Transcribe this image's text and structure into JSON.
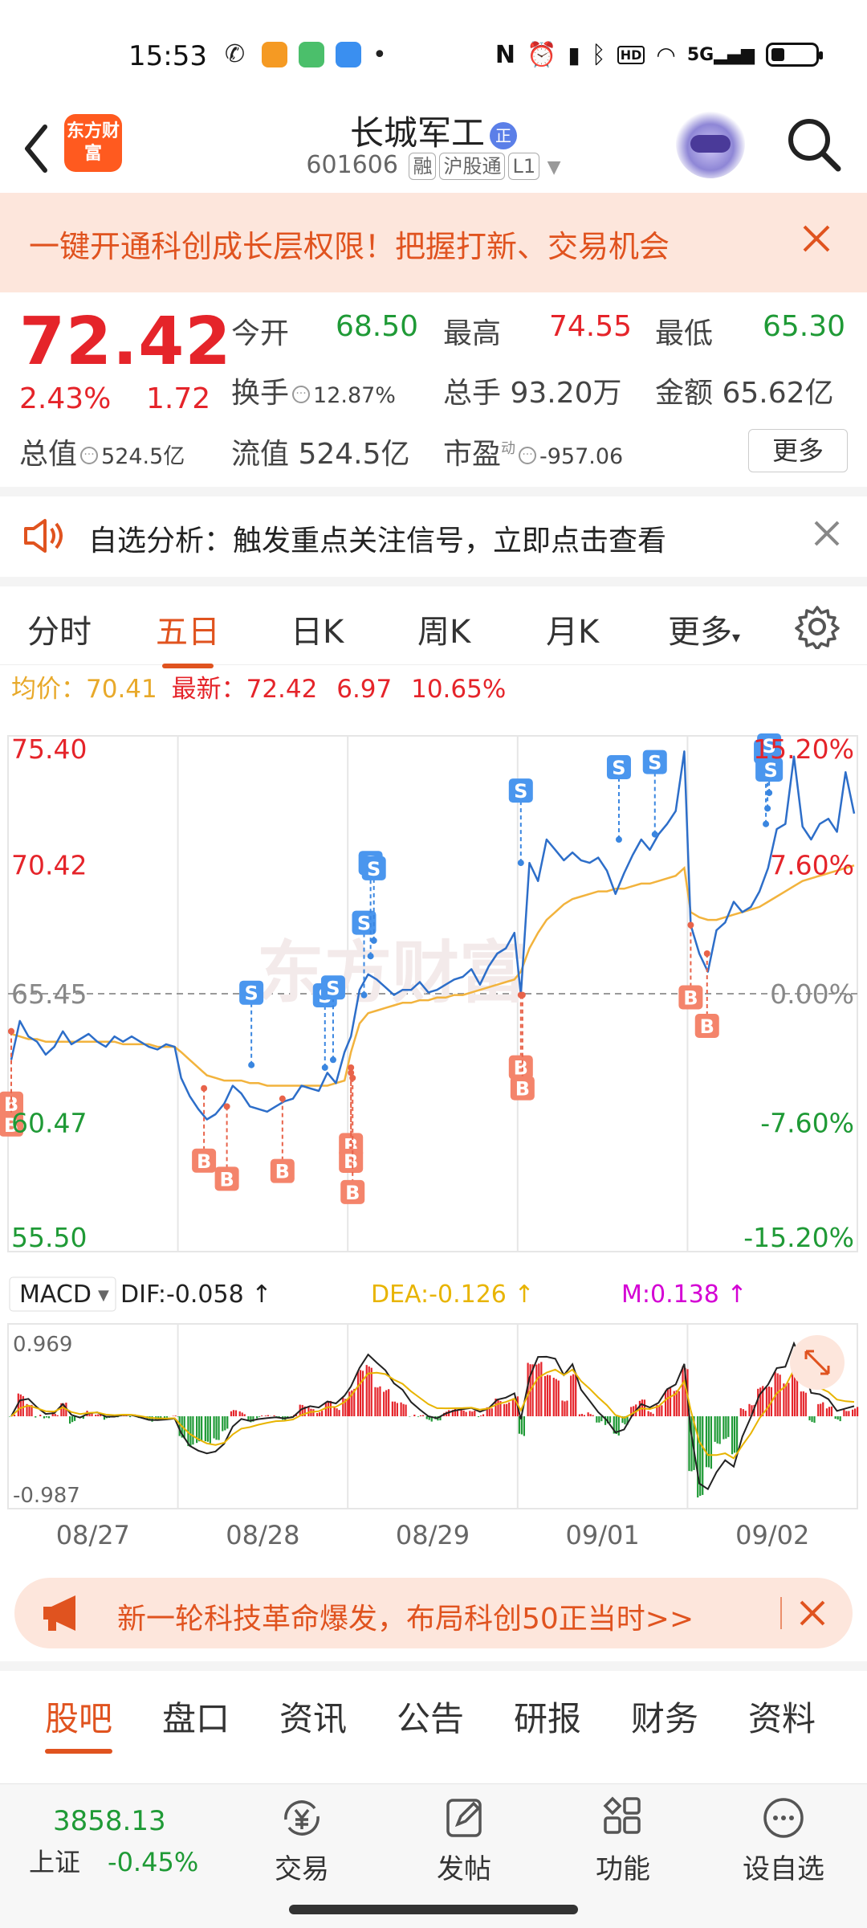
{
  "status_bar": {
    "time": "15:53",
    "network": "5G",
    "hd": "HD"
  },
  "header": {
    "logo": "东方财富",
    "title": "长城军工",
    "title_badge": "正",
    "code": "601606",
    "tags": [
      "融",
      "沪股通",
      "L1"
    ]
  },
  "banner_top": {
    "text": "一键开通科创成长层权限！把握打新、交易机会"
  },
  "quote": {
    "price": "72.42",
    "pct": "2.43%",
    "change": "1.72",
    "open_label": "今开",
    "open": "68.50",
    "high_label": "最高",
    "high": "74.55",
    "low_label": "最低",
    "low": "65.30",
    "turnover_label": "换手",
    "turnover": "12.87%",
    "volume_label": "总手",
    "volume": "93.20万",
    "amount_label": "金额",
    "amount": "65.62亿",
    "mcap_label": "总值",
    "mcap": "524.5亿",
    "float_label": "流值",
    "float": "524.5亿",
    "pe_label": "市盈",
    "pe_sup": "动",
    "pe": "-957.06",
    "more": "更多"
  },
  "notice": {
    "text": "自选分析：触发重点关注信号，立即点击查看"
  },
  "chart_tabs": [
    "分时",
    "五日",
    "日K",
    "周K",
    "月K",
    "更多"
  ],
  "chart_tabs_active": 1,
  "avg_line": {
    "avg_label": "均价：",
    "avg": "70.41",
    "last_label": "最新：",
    "last": "72.42",
    "chg": "6.97",
    "pct": "10.65%"
  },
  "chart_data": {
    "type": "line",
    "days": [
      "08/27",
      "08/28",
      "08/29",
      "09/01",
      "09/02"
    ],
    "y_left_ticks": [
      "75.40",
      "70.42",
      "65.45",
      "60.47",
      "55.50"
    ],
    "y_right_ticks": [
      "15.20%",
      "7.60%",
      "0.00%",
      "-7.60%",
      "-15.20%"
    ],
    "ylim": [
      55.5,
      75.4
    ],
    "prev_close": 65.45,
    "series": [
      {
        "name": "price",
        "color": "#2d6ec9",
        "values": [
          62.9,
          64.4,
          63.8,
          63.6,
          63.1,
          63.4,
          64.0,
          63.5,
          63.7,
          63.9,
          63.6,
          63.4,
          63.8,
          63.6,
          63.8,
          63.6,
          63.4,
          63.3,
          63.5,
          63.4,
          62.2,
          61.5,
          61.0,
          60.6,
          60.8,
          61.2,
          61.9,
          61.6,
          61.1,
          61.0,
          60.9,
          61.1,
          61.3,
          61.4,
          61.9,
          61.8,
          61.7,
          62.4,
          62.0,
          63.2,
          63.8,
          65.6,
          66.2,
          66.0,
          65.7,
          65.4,
          65.6,
          65.6,
          65.9,
          65.5,
          65.6,
          65.8,
          66.0,
          66.1,
          66.4,
          65.8,
          66.5,
          67.0,
          67.2,
          67.8,
          65.4,
          70.5,
          69.8,
          71.4,
          71.0,
          70.6,
          70.9,
          70.6,
          70.5,
          70.7,
          70.2,
          69.3,
          70.1,
          70.8,
          71.4,
          71.0,
          71.6,
          72.0,
          72.5,
          74.8,
          68.1,
          67.0,
          66.3,
          67.9,
          68.2,
          69.0,
          68.6,
          68.8,
          69.4,
          70.3,
          71.8,
          72.0,
          74.6,
          71.9,
          71.4,
          72.0,
          72.2,
          71.7,
          74.0,
          72.4
        ]
      },
      {
        "name": "avg",
        "color": "#f2b33d",
        "values": [
          63.9,
          63.8,
          63.7,
          63.7,
          63.6,
          63.6,
          63.6,
          63.6,
          63.6,
          63.6,
          63.6,
          63.6,
          63.6,
          63.5,
          63.5,
          63.5,
          63.5,
          63.4,
          63.4,
          63.4,
          63.2,
          62.9,
          62.6,
          62.3,
          62.2,
          62.1,
          62.1,
          62.1,
          62.0,
          62.0,
          61.9,
          61.9,
          61.9,
          61.9,
          61.9,
          61.9,
          61.9,
          61.9,
          62.0,
          62.1,
          63.2,
          64.3,
          64.7,
          64.8,
          64.9,
          65.0,
          65.1,
          65.1,
          65.2,
          65.2,
          65.3,
          65.3,
          65.4,
          65.4,
          65.5,
          65.6,
          65.7,
          65.8,
          65.9,
          66.0,
          66.3,
          67.2,
          67.8,
          68.3,
          68.6,
          68.9,
          69.1,
          69.2,
          69.3,
          69.4,
          69.4,
          69.5,
          69.5,
          69.6,
          69.7,
          69.7,
          69.8,
          69.9,
          70.0,
          70.3,
          68.6,
          68.4,
          68.3,
          68.3,
          68.4,
          68.5,
          68.6,
          68.7,
          68.8,
          69.0,
          69.2,
          69.4,
          69.6,
          69.8,
          69.9,
          70.0,
          70.1,
          70.2,
          70.3,
          70.4
        ]
      }
    ],
    "signals": [
      {
        "type": "B",
        "day": 0,
        "frac": 0.0,
        "price": 64.0
      },
      {
        "type": "B",
        "day": 0,
        "frac": 0.0,
        "price": 64.0
      },
      {
        "type": "B",
        "day": 1,
        "frac": 0.14,
        "price": 61.8
      },
      {
        "type": "B",
        "day": 1,
        "frac": 0.28,
        "price": 61.1
      },
      {
        "type": "B",
        "day": 1,
        "frac": 0.62,
        "price": 61.4
      },
      {
        "type": "S",
        "day": 1,
        "frac": 0.43,
        "price": 62.7
      },
      {
        "type": "B",
        "day": 2,
        "frac": 0.0,
        "price": 62.4
      },
      {
        "type": "B",
        "day": 2,
        "frac": 0.0,
        "price": 62.6
      },
      {
        "type": "B",
        "day": 2,
        "frac": 0.01,
        "price": 62.2
      },
      {
        "type": "S",
        "day": 1,
        "frac": 0.88,
        "price": 62.6
      },
      {
        "type": "S",
        "day": 1,
        "frac": 0.93,
        "price": 62.9
      },
      {
        "type": "S",
        "day": 2,
        "frac": 0.08,
        "price": 65.4
      },
      {
        "type": "S",
        "day": 2,
        "frac": 0.12,
        "price": 66.9
      },
      {
        "type": "S",
        "day": 2,
        "frac": 0.14,
        "price": 67.5
      },
      {
        "type": "S",
        "day": 3,
        "frac": 0.0,
        "price": 70.5
      },
      {
        "type": "B",
        "day": 3,
        "frac": 0.0,
        "price": 65.4
      },
      {
        "type": "B",
        "day": 3,
        "frac": 0.01,
        "price": 65.4
      },
      {
        "type": "S",
        "day": 3,
        "frac": 0.6,
        "price": 71.4
      },
      {
        "type": "S",
        "day": 3,
        "frac": 0.82,
        "price": 71.6
      },
      {
        "type": "B",
        "day": 4,
        "frac": 0.0,
        "price": 68.1
      },
      {
        "type": "B",
        "day": 4,
        "frac": 0.1,
        "price": 67.0
      },
      {
        "type": "S",
        "day": 4,
        "frac": 0.46,
        "price": 72.0
      },
      {
        "type": "S",
        "day": 4,
        "frac": 0.47,
        "price": 72.6
      },
      {
        "type": "S",
        "day": 4,
        "frac": 0.48,
        "price": 73.2
      },
      {
        "type": "S",
        "day": 4,
        "frac": 0.49,
        "price": 73.8
      }
    ]
  },
  "macd": {
    "label": "MACD",
    "dif": "DIF:-0.058",
    "dea": "DEA:-0.126",
    "m": "M:0.138",
    "ymax": "0.969",
    "ymin": "-0.987",
    "colors": {
      "dif": "#222222",
      "dea": "#e8b400",
      "m": "#d400d4",
      "up": "#e5242a",
      "down": "#1f9a36"
    }
  },
  "banner_bottom": {
    "text": "新一轮科技革命爆发，布局科创50正当时>>"
  },
  "bottom_tabs": [
    "股吧",
    "盘口",
    "资讯",
    "公告",
    "研报",
    "财务",
    "资料"
  ],
  "bottom_tabs_active": 0,
  "bottom_nav": {
    "index_value": "3858.13",
    "index_name": "上证",
    "index_pct": "-0.45%",
    "items": [
      "交易",
      "发帖",
      "功能",
      "设自选"
    ]
  }
}
